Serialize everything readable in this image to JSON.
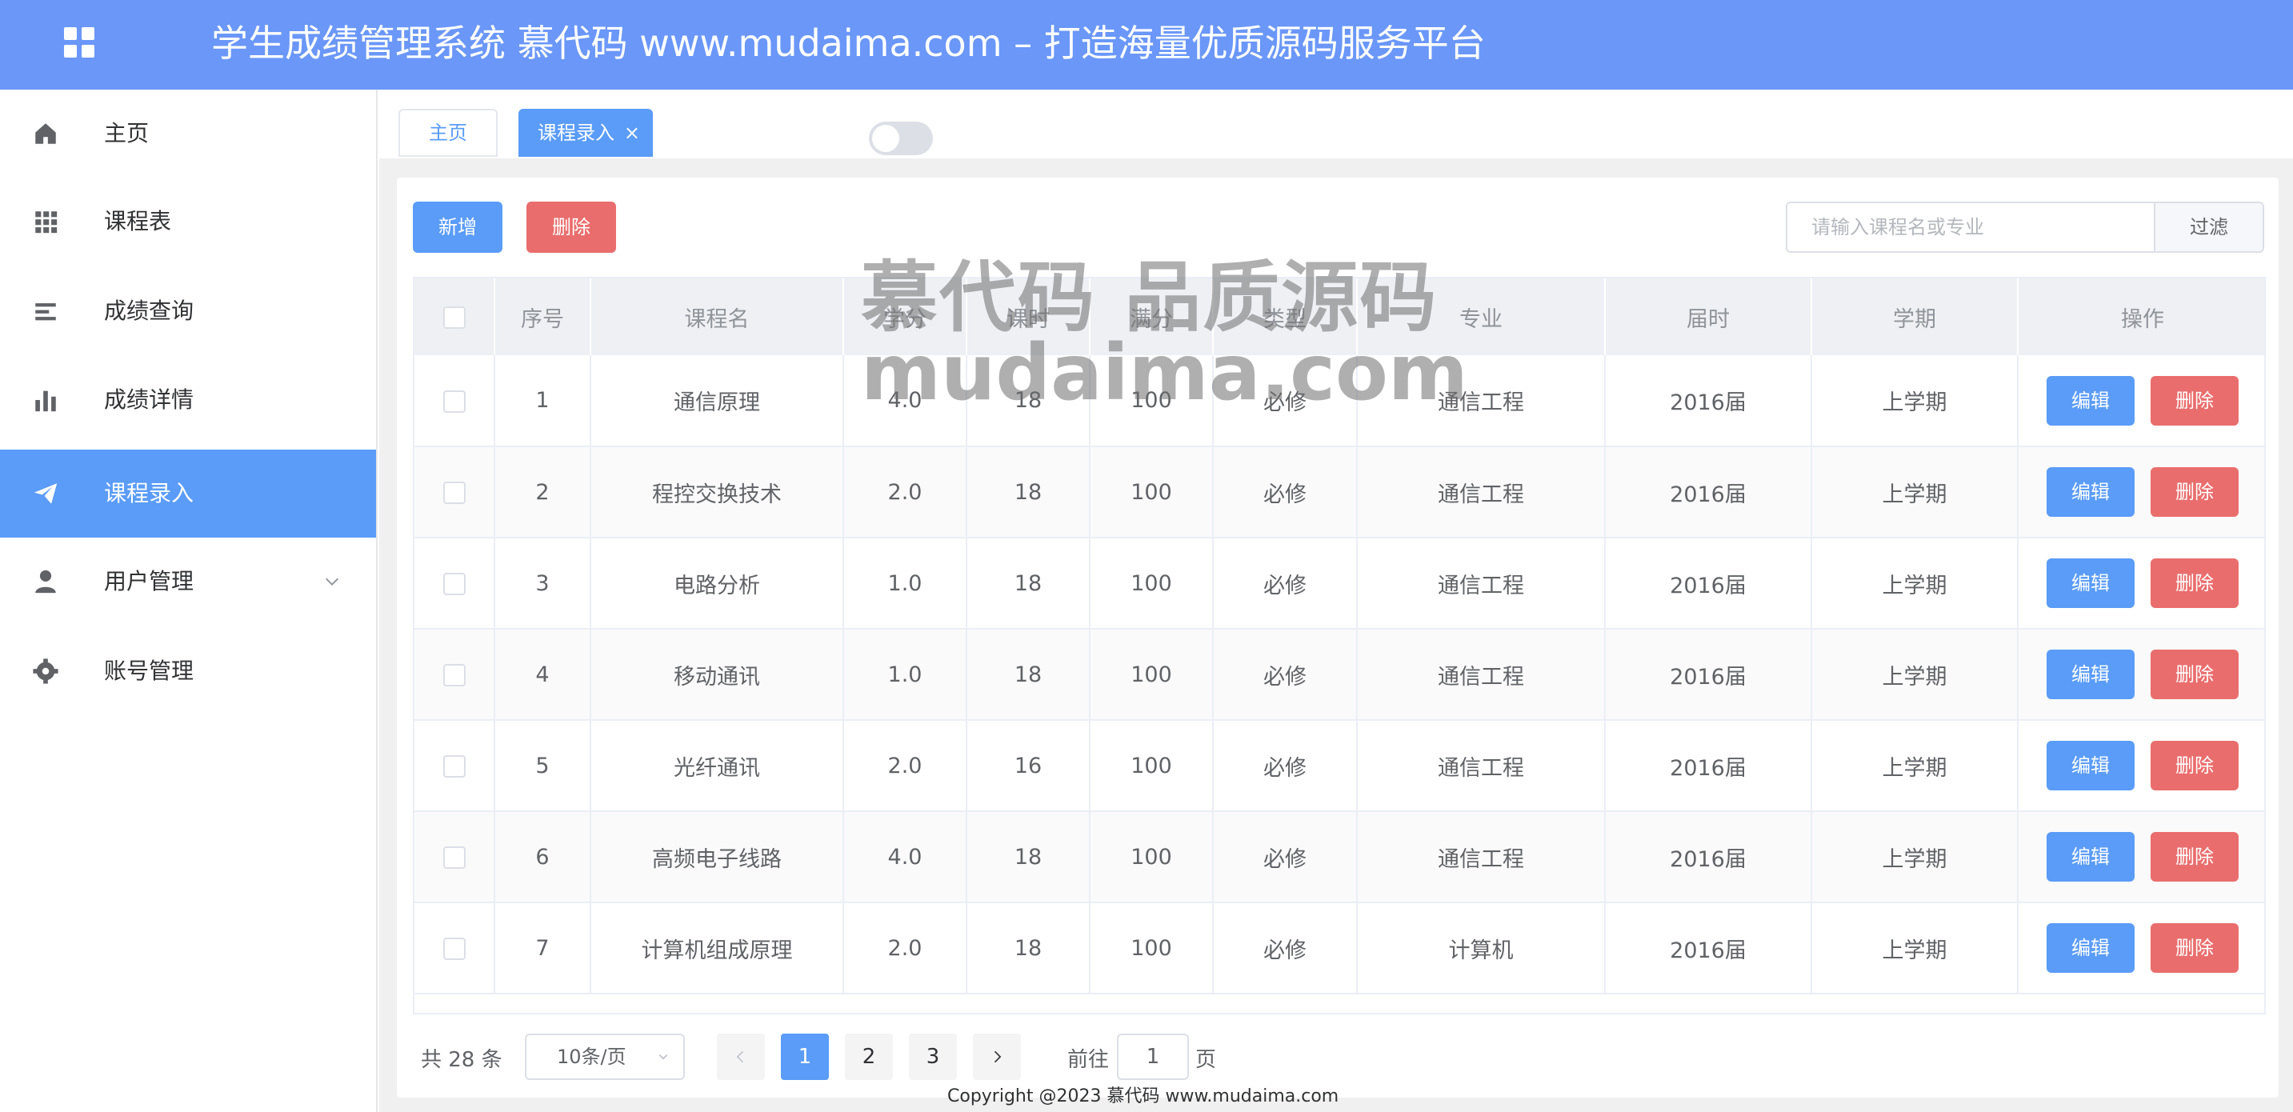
{
  "header": {
    "title": "学生成绩管理系统 慕代码 www.mudaima.com – 打造海量优质源码服务平台"
  },
  "sidebar": {
    "items": [
      {
        "label": "主页",
        "icon": "home-icon"
      },
      {
        "label": "课程表",
        "icon": "grid-icon"
      },
      {
        "label": "成绩查询",
        "icon": "list-icon"
      },
      {
        "label": "成绩详情",
        "icon": "bar-chart-icon"
      },
      {
        "label": "课程录入",
        "icon": "send-icon",
        "active": true
      },
      {
        "label": "用户管理",
        "icon": "user-icon"
      },
      {
        "label": "账号管理",
        "icon": "gear-icon"
      }
    ]
  },
  "tabs": [
    {
      "label": "主页"
    },
    {
      "label": "课程录入",
      "close": "×"
    }
  ],
  "toolbar": {
    "add_label": "新增",
    "delete_label": "删除",
    "search_placeholder": "请输入课程名或专业",
    "filter_label": "过滤"
  },
  "table": {
    "headers": [
      "序号",
      "课程名",
      "学分",
      "课时",
      "满分",
      "类型",
      "专业",
      "届时",
      "学期",
      "操作"
    ],
    "rows": [
      [
        "1",
        "通信原理",
        "4.0",
        "18",
        "100",
        "必修",
        "通信工程",
        "2016届",
        "上学期"
      ],
      [
        "2",
        "程控交换技术",
        "2.0",
        "18",
        "100",
        "必修",
        "通信工程",
        "2016届",
        "上学期"
      ],
      [
        "3",
        "电路分析",
        "1.0",
        "18",
        "100",
        "必修",
        "通信工程",
        "2016届",
        "上学期"
      ],
      [
        "4",
        "移动通讯",
        "1.0",
        "18",
        "100",
        "必修",
        "通信工程",
        "2016届",
        "上学期"
      ],
      [
        "5",
        "光纤通讯",
        "2.0",
        "16",
        "100",
        "必修",
        "通信工程",
        "2016届",
        "上学期"
      ],
      [
        "6",
        "高频电子线路",
        "4.0",
        "18",
        "100",
        "必修",
        "通信工程",
        "2016届",
        "上学期"
      ],
      [
        "7",
        "计算机组成原理",
        "2.0",
        "18",
        "100",
        "必修",
        "计算机",
        "2016届",
        "上学期"
      ]
    ],
    "edit_label": "编辑",
    "row_delete_label": "删除"
  },
  "pagination": {
    "total": "共 28 条",
    "page_size": "10条/页",
    "pages": [
      "1",
      "2",
      "3"
    ],
    "current_page": "1",
    "goto_label": "前往",
    "goto_value": "1",
    "goto_suffix": "页"
  },
  "footer": {
    "copyright": "Copyright @2023 慕代码 www.mudaima.com"
  },
  "watermark": {
    "line1": "慕代码 品质源码",
    "line2": "mudaima.com"
  },
  "colors": {
    "header": "#6a97f8",
    "primary": "#5a9cf7",
    "danger": "#ea6d6d"
  }
}
